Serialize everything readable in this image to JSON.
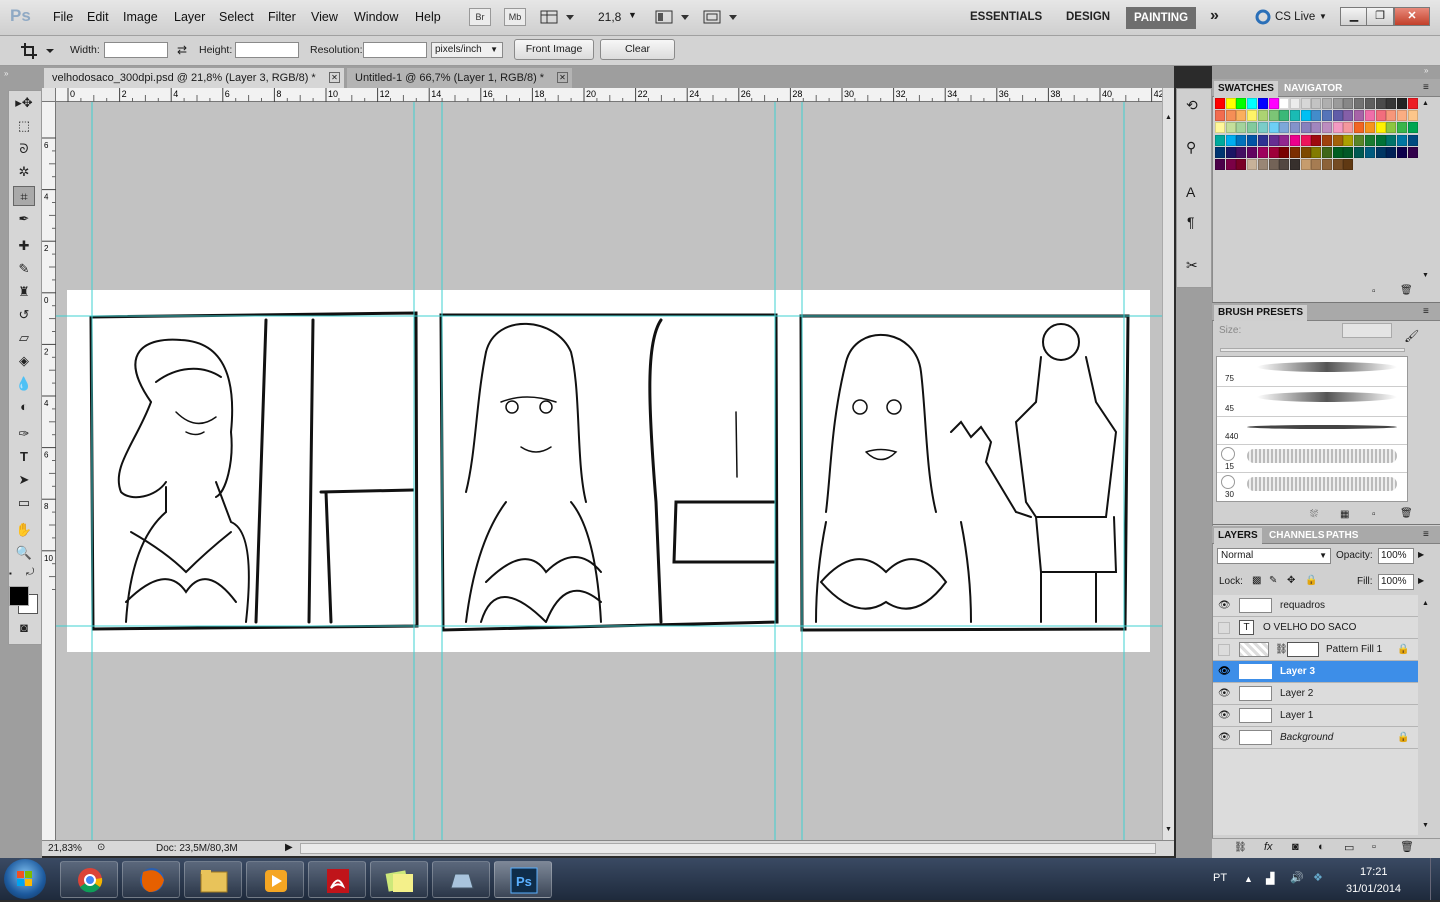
{
  "app": {
    "logo": "Ps"
  },
  "menu": [
    "File",
    "Edit",
    "Image",
    "Layer",
    "Select",
    "Filter",
    "View",
    "Window",
    "Help"
  ],
  "appbar": {
    "bridge": "Br",
    "minibridge": "Mb",
    "zoom": "21,8",
    "workspaces": [
      "ESSENTIALS",
      "DESIGN",
      "PAINTING"
    ],
    "more": "»",
    "cslive": "CS Live"
  },
  "options": {
    "width_label": "Width:",
    "height_label": "Height:",
    "resolution_label": "Resolution:",
    "width_value": "",
    "height_value": "",
    "resolution_value": "",
    "units": "pixels/inch",
    "front_image": "Front Image",
    "clear": "Clear"
  },
  "documents": [
    {
      "title": "velhodosaco_300dpi.psd @ 21,8% (Layer 3, RGB/8) *",
      "active": true
    },
    {
      "title": "Untitled-1 @ 66,7% (Layer 1, RGB/8) *",
      "active": false
    }
  ],
  "ruler": {
    "h_ticks": [
      "0",
      "2",
      "4",
      "6",
      "8",
      "10",
      "12",
      "14",
      "16",
      "18",
      "20",
      "22",
      "24",
      "26",
      "28",
      "30",
      "32",
      "34",
      "36",
      "38",
      "40",
      "42"
    ],
    "v_ticks": [
      "6",
      "4",
      "2",
      "0",
      "2",
      "4",
      "6",
      "8",
      "10"
    ]
  },
  "status": {
    "zoom": "21,83%",
    "doc": "Doc: 23,5M/80,3M"
  },
  "panels": {
    "swatches_tabs": [
      "SWATCHES",
      "NAVIGATOR"
    ],
    "brush_tabs": [
      "BRUSH PRESETS"
    ],
    "brush_size_label": "Size:",
    "brush_sizes": [
      "75",
      "45",
      "440",
      "15",
      "30"
    ],
    "layers_tabs": [
      "LAYERS",
      "CHANNELS",
      "PATHS"
    ],
    "blend_mode": "Normal",
    "opacity_label": "Opacity:",
    "opacity": "100%",
    "lock_label": "Lock:",
    "fill_label": "Fill:",
    "fill": "100%"
  },
  "layers": [
    {
      "name": "requadros",
      "visible": true,
      "selected": false,
      "italic": false,
      "locked": false
    },
    {
      "name": "O VELHO DO SACO",
      "visible": false,
      "selected": false,
      "italic": false,
      "locked": false
    },
    {
      "name": "Pattern Fill 1",
      "visible": false,
      "selected": false,
      "italic": false,
      "locked": true
    },
    {
      "name": "Layer 3",
      "visible": true,
      "selected": true,
      "italic": false,
      "locked": false
    },
    {
      "name": "Layer 2",
      "visible": true,
      "selected": false,
      "italic": false,
      "locked": false
    },
    {
      "name": "Layer 1",
      "visible": true,
      "selected": false,
      "italic": false,
      "locked": false
    },
    {
      "name": "Background",
      "visible": true,
      "selected": false,
      "italic": true,
      "locked": true
    }
  ],
  "taskbar": {
    "lang": "PT",
    "time": "17:21",
    "date": "31/01/2014"
  },
  "colors": {
    "accent": "#3d8ee8",
    "guide": "#3fd0d0",
    "canvas_bg": "#c2c2c2"
  }
}
